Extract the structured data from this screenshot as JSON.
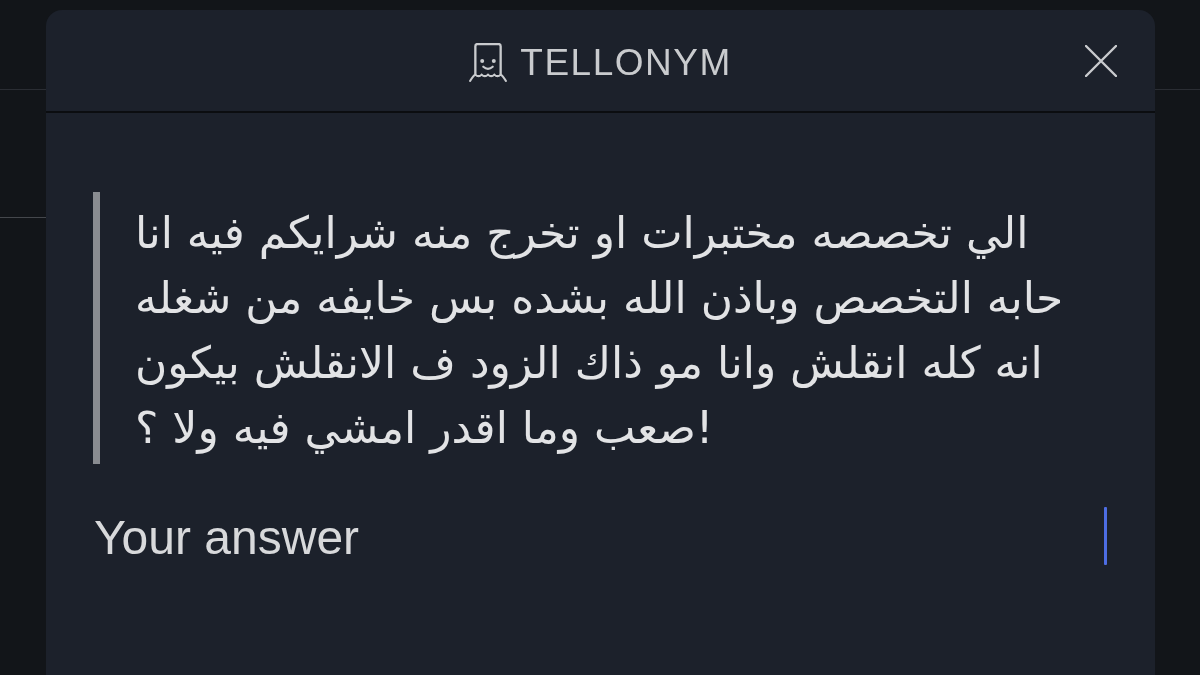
{
  "header": {
    "brand": "TELLONYM"
  },
  "question": {
    "text": "الي تخصصه مختبرات او تخرج منه شرايكم فيه انا\nحابه التخصص وباذن الله بشده بس خايفه من شغله\nانه كله انقلش وانا مو ذاك الزود ف الانقلش بيكون\nصعب وما اقدر امشي فيه ولا ؟!"
  },
  "answer": {
    "placeholder": "Your answer"
  }
}
